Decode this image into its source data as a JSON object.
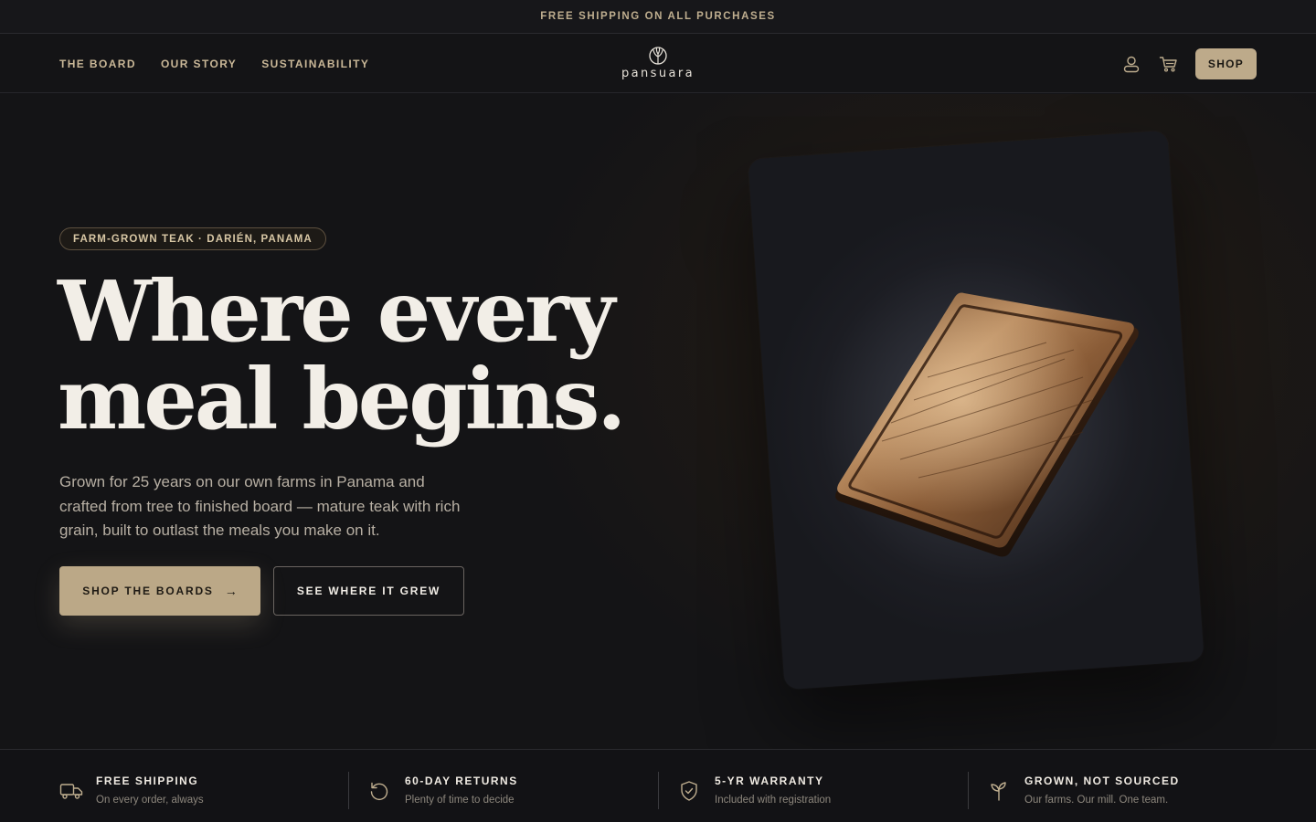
{
  "announcement": "FREE SHIPPING ON ALL PURCHASES",
  "nav": {
    "links": [
      "THE BOARD",
      "OUR STORY",
      "SUSTAINABILITY"
    ],
    "logo_text": "pansuara",
    "user_icon": "user-icon",
    "cart_icon": "cart-icon",
    "shop_label": "SHOP"
  },
  "hero": {
    "badge": "FARM-GROWN TEAK · DARIÉN, PANAMA",
    "headline_line1": "Where every",
    "headline_line2": "meal begins.",
    "subcopy": "Grown for 25 years on our own farms in Panama and crafted from tree to finished board — mature teak with rich grain, built to outlast the meals you make on it.",
    "primary_cta": "SHOP THE BOARDS",
    "primary_cta_arrow": "→",
    "secondary_cta": "SEE WHERE IT GREW"
  },
  "features": [
    {
      "icon": "truck-icon",
      "title": "FREE SHIPPING",
      "subtitle": "On every order, always"
    },
    {
      "icon": "returns-icon",
      "title": "60-DAY RETURNS",
      "subtitle": "Plenty of time to decide"
    },
    {
      "icon": "shield-icon",
      "title": "5-YR WARRANTY",
      "subtitle": "Included with registration"
    },
    {
      "icon": "sprout-icon",
      "title": "GROWN, NOT SOURCED",
      "subtitle": "Our farms. Our mill. One team."
    }
  ],
  "colors": {
    "background": "#141416",
    "accent": "#bba887",
    "accent_text": "#c9b797",
    "headline": "#f2eee7"
  }
}
